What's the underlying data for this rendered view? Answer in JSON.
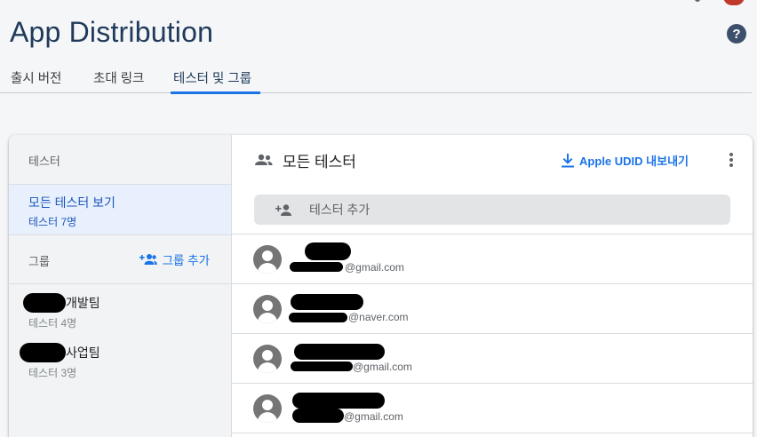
{
  "header": {
    "title": "App Distribution",
    "help_icon_glyph": "?"
  },
  "tabs": [
    {
      "label": "출시 버전",
      "active": false
    },
    {
      "label": "초대 링크",
      "active": false
    },
    {
      "label": "테스터 및 그룹",
      "active": true
    }
  ],
  "left_panel": {
    "testers_header": "테스터",
    "all_testers": {
      "label": "모든 테스터 보기",
      "count": "테스터 7명"
    },
    "groups_header": "그룹",
    "add_group_label": "그룹 추가",
    "groups": [
      {
        "name_suffix": "개발팀",
        "count": "테스터 4명"
      },
      {
        "name_suffix": "사업팀",
        "count": "테스터 3명"
      }
    ]
  },
  "right_panel": {
    "title": "모든 테스터",
    "export_label": "Apple UDID 내보내기",
    "add_tester_placeholder": "테스터 추가",
    "testers": [
      {
        "email_suffix": "@gmail.com"
      },
      {
        "email_suffix": "@naver.com"
      },
      {
        "email_suffix": "@gmail.com"
      },
      {
        "email_suffix": "@gmail.com"
      }
    ]
  },
  "colors": {
    "accent": "#1a73e8",
    "title": "#1f3a5a",
    "selected_bg": "#e8f0fe",
    "redaction": "#000000"
  },
  "icons": {
    "help": "help-circle-icon",
    "group": "group-icon",
    "add_group": "group-add-icon",
    "download": "download-icon",
    "more": "more-vert-icon",
    "add_person": "person-add-icon",
    "avatar": "account-circle-icon"
  }
}
